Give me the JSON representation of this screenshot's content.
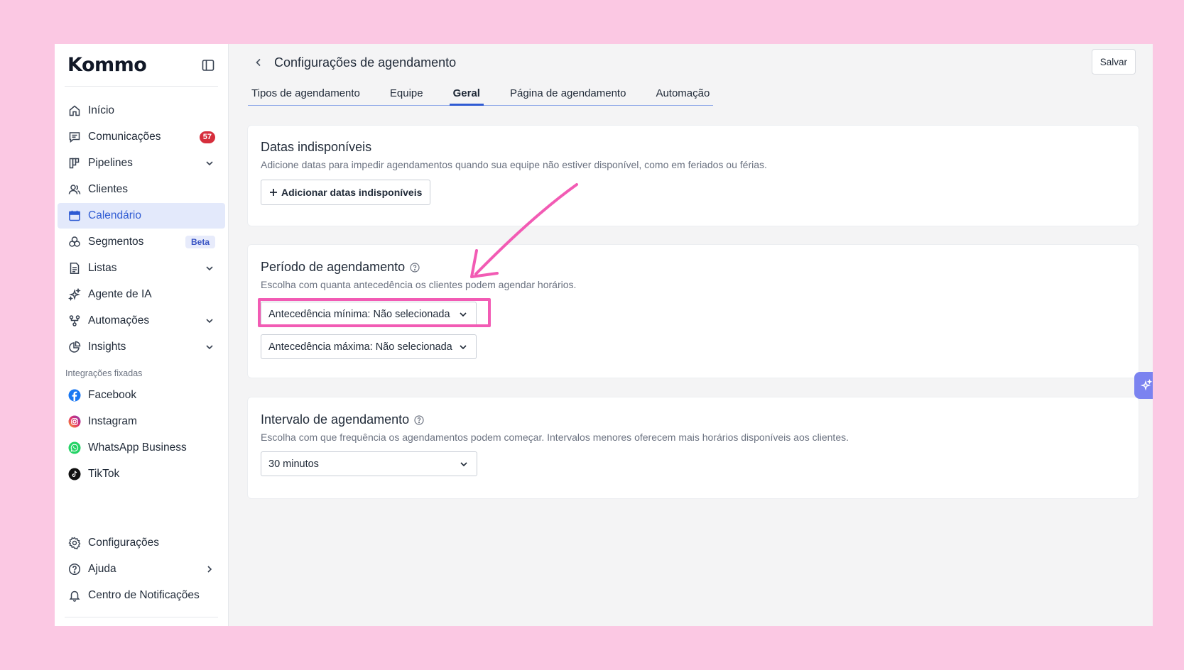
{
  "app": {
    "logo": "Kommo"
  },
  "sidebar": {
    "items": [
      {
        "key": "inicio",
        "label": "Início",
        "icon": "home-icon"
      },
      {
        "key": "comunicacoes",
        "label": "Comunicações",
        "icon": "chat-icon",
        "badge": "57"
      },
      {
        "key": "pipelines",
        "label": "Pipelines",
        "icon": "pipeline-icon"
      },
      {
        "key": "clientes",
        "label": "Clientes",
        "icon": "users-icon"
      },
      {
        "key": "calendario",
        "label": "Calendário",
        "icon": "calendar-icon"
      },
      {
        "key": "segmentos",
        "label": "Segmentos",
        "icon": "segments-icon",
        "tag": "Beta"
      },
      {
        "key": "listas",
        "label": "Listas",
        "icon": "list-icon"
      },
      {
        "key": "agente-ia",
        "label": "Agente de IA",
        "icon": "sparkles-icon"
      },
      {
        "key": "automacoes",
        "label": "Automações",
        "icon": "automation-icon"
      },
      {
        "key": "insights",
        "label": "Insights",
        "icon": "chart-pie-icon"
      }
    ],
    "pinned_label": "Integrações fixadas",
    "pinned": [
      {
        "key": "facebook",
        "label": "Facebook",
        "icon": "facebook-icon"
      },
      {
        "key": "instagram",
        "label": "Instagram",
        "icon": "instagram-icon"
      },
      {
        "key": "whatsapp",
        "label": "WhatsApp Business",
        "icon": "whatsapp-icon"
      },
      {
        "key": "tiktok",
        "label": "TikTok",
        "icon": "tiktok-icon"
      }
    ],
    "bottom": [
      {
        "key": "configuracoes",
        "label": "Configurações",
        "icon": "gear-icon"
      },
      {
        "key": "ajuda",
        "label": "Ajuda",
        "icon": "help-circle-icon"
      },
      {
        "key": "notificacoes",
        "label": "Centro de Notificações",
        "icon": "bell-icon"
      }
    ]
  },
  "header": {
    "title": "Configurações de agendamento",
    "save_label": "Salvar"
  },
  "tabs": [
    {
      "label": "Tipos de agendamento"
    },
    {
      "label": "Equipe"
    },
    {
      "label": "Geral",
      "active": true
    },
    {
      "label": "Página de agendamento"
    },
    {
      "label": "Automação"
    }
  ],
  "unavailable": {
    "title": "Datas indisponíveis",
    "description": "Adicione datas para impedir agendamentos quando sua equipe não estiver disponível, como em feriados ou férias.",
    "add_label": "Adicionar datas indisponíveis"
  },
  "period": {
    "title": "Período de agendamento",
    "description": "Escolha com quanta antecedência os clientes podem agendar horários.",
    "min_value": "Antecedência mínima: Não selecionada",
    "max_value": "Antecedência máxima: Não selecionada"
  },
  "interval": {
    "title": "Intervalo de agendamento",
    "description": "Escolha com que frequência os agendamentos podem começar. Intervalos menores oferecem mais horários disponíveis aos clientes.",
    "value": "30 minutos"
  },
  "colors": {
    "accent": "#2f5bd3",
    "badge": "#d62e3c",
    "annotation": "#f25bb4",
    "page_bg": "#fbc8e3"
  }
}
